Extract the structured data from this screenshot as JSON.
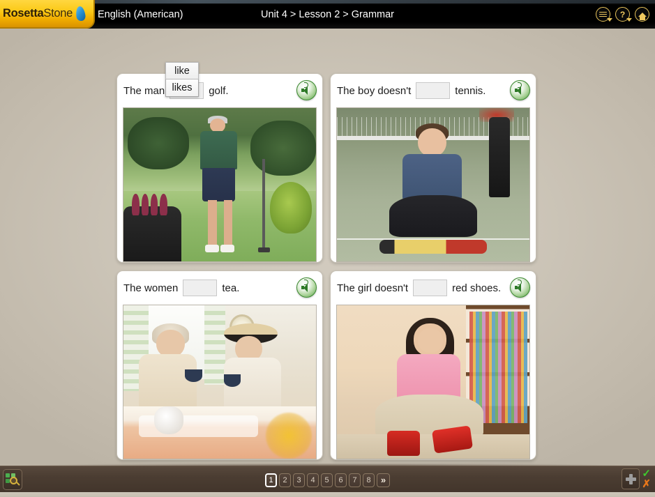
{
  "header": {
    "logo": {
      "brand_first": "Rosetta",
      "brand_second": "Stone",
      "stone_icon": "stone-glyph"
    },
    "language": "English (American)",
    "breadcrumb": "Unit 4 > Lesson 2 > Grammar",
    "icons": [
      {
        "name": "menu-list-icon",
        "label": ""
      },
      {
        "name": "help-icon",
        "label": "?"
      },
      {
        "name": "home-icon",
        "label": ""
      }
    ]
  },
  "exercise": {
    "cards": [
      {
        "id": "card-man-golf",
        "before": "The man",
        "after": "golf.",
        "blank_filled": true,
        "blank_value": "likes",
        "image_alt": "man-with-golf-club-on-course",
        "speaker": "speaker-icon"
      },
      {
        "id": "card-boy-tennis",
        "before": "The boy doesn't",
        "after": "tennis.",
        "blank_filled": false,
        "blank_value": "",
        "image_alt": "boy-sitting-with-tennis-racket",
        "speaker": "speaker-icon"
      },
      {
        "id": "card-women-tea",
        "before": "The women",
        "after": "tea.",
        "blank_filled": false,
        "blank_value": "",
        "image_alt": "two-women-drinking-tea",
        "speaker": "speaker-icon"
      },
      {
        "id": "card-girl-shoes",
        "before": "The girl doesn't",
        "after": "red shoes.",
        "blank_filled": false,
        "blank_value": "",
        "image_alt": "girl-putting-on-red-boots",
        "speaker": "speaker-icon"
      }
    ]
  },
  "dropdown": {
    "visible": true,
    "options": [
      "like",
      "likes"
    ],
    "selected": "likes",
    "selected_index": 1
  },
  "footer": {
    "zoom_icon": "image-zoom-icon",
    "pages": [
      "1",
      "2",
      "3",
      "4",
      "5",
      "6",
      "7",
      "8"
    ],
    "active_page": "1",
    "next_label": "»",
    "plus_icon": "plus-icon",
    "check_icon": "check-mark-icon",
    "cross_icon": "cross-mark-icon"
  },
  "colors": {
    "brand_yellow": "#fbc916",
    "stage_bg": "#cdc6b9",
    "footer_brown": "#4b3d32",
    "speaker_green": "#4e9e3f",
    "correct_green": "#3ecb2e",
    "incorrect_orange": "#e8771a"
  }
}
